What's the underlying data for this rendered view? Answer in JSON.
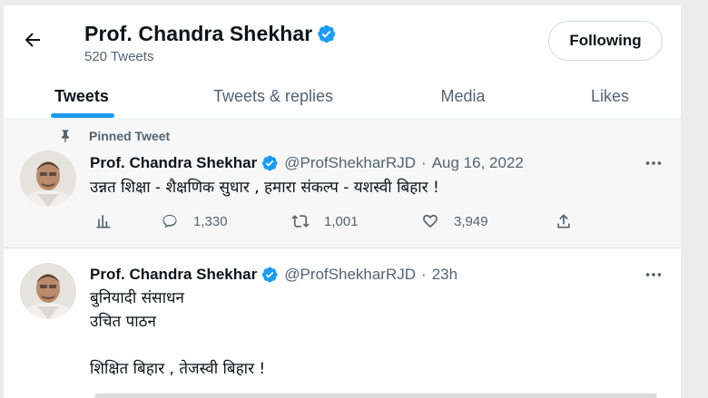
{
  "header": {
    "title": "Prof. Chandra Shekhar",
    "tweet_count": "520 Tweets",
    "follow_label": "Following"
  },
  "tabs": [
    {
      "label": "Tweets",
      "active": true
    },
    {
      "label": "Tweets & replies",
      "active": false
    },
    {
      "label": "Media",
      "active": false
    },
    {
      "label": "Likes",
      "active": false
    }
  ],
  "colors": {
    "accent": "#1d9bf0",
    "text_primary": "#0f1419",
    "text_secondary": "#536471"
  },
  "tweets": [
    {
      "pinned_label": "Pinned Tweet",
      "name": "Prof. Chandra Shekhar",
      "handle": "@ProfShekharRJD",
      "separator": "·",
      "date": "Aug 16, 2022",
      "text": "उन्नत शिक्षा - शैक्षणिक सुधार , हमारा संकल्प - यशस्वी बिहार !",
      "stats": {
        "replies": "1,330",
        "retweets": "1,001",
        "likes": "3,949"
      }
    },
    {
      "name": "Prof. Chandra Shekhar",
      "handle": "@ProfShekharRJD",
      "separator": "·",
      "date": "23h",
      "lines": [
        "बुनियादी संसाधन",
        "उचित पाठन",
        "",
        "शिक्षित बिहार , तेजस्वी बिहार !"
      ]
    }
  ],
  "icons": {
    "back": "arrow-left-icon",
    "verified": "verified-badge-icon",
    "pin": "pin-icon",
    "more": "more-horizontal-icon",
    "views": "views-chart-icon",
    "reply": "reply-icon",
    "retweet": "retweet-icon",
    "like": "heart-icon",
    "share": "share-icon"
  }
}
